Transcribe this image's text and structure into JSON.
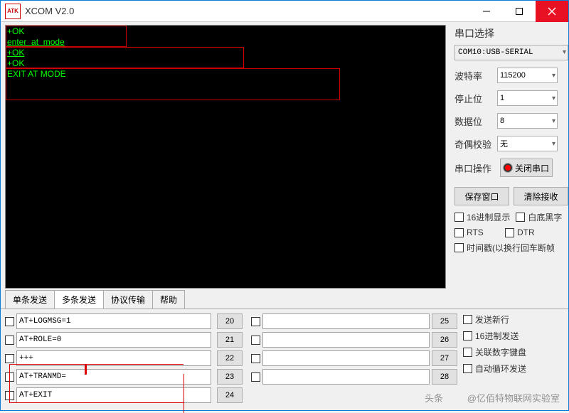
{
  "app_title": "XCOM V2.0",
  "logo": "ATK",
  "terminal": {
    "l1": "+OK",
    "l2": "enter_at_mode",
    "l3": "+OK",
    "l4": "+OK",
    "l5": "EXIT AT MODE"
  },
  "side": {
    "title": "串口选择",
    "port": "COM10:USB-SERIAL",
    "baud_label": "波特率",
    "baud": "115200",
    "stop_label": "停止位",
    "stop": "1",
    "data_label": "数据位",
    "data": "8",
    "parity_label": "奇偶校验",
    "parity": "无",
    "op_label": "串口操作",
    "op_btn": "关闭串口",
    "save_btn": "保存窗口",
    "clear_btn": "清除接收",
    "hex_show": "16进制显示",
    "white_bg": "白底黑字",
    "rts": "RTS",
    "dtr": "DTR",
    "timestamp": "时间戳(以换行回车断帧"
  },
  "tabs": {
    "single": "单条发送",
    "multi": "多条发送",
    "proto": "协议传输",
    "help": "帮助"
  },
  "send": {
    "r1": "AT+LOGMSG=1",
    "r2": "AT+ROLE=0",
    "r3": "+++",
    "r4": "AT+TRANMD=",
    "r5": "AT+EXIT",
    "n20": "20",
    "n21": "21",
    "n22": "22",
    "n23": "23",
    "n24": "24",
    "n25": "25",
    "n26": "26",
    "n27": "27",
    "n28": "28",
    "opt_newline": "发送新行",
    "opt_hexsend": "16进制发送",
    "opt_numpad": "关联数字键盘",
    "opt_loop": "自动循环发送"
  },
  "watermark": {
    "head": "头条",
    "author": "@亿佰特物联网实验室"
  }
}
